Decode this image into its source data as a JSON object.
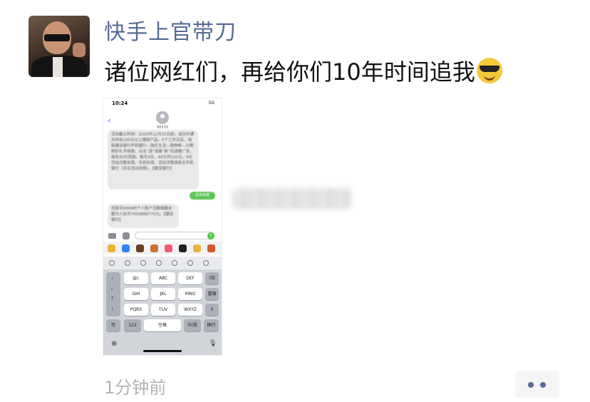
{
  "post": {
    "username": "快手上官带刀",
    "text": "诸位网红们，再给你们10年时间追我",
    "emoji": "sunglasses-smile",
    "time_ago": "1分钟前"
  },
  "screenshot": {
    "status_time": "10:24",
    "status_signal": "5G",
    "back_glyph": "‹",
    "contact_name": "95533",
    "message_in_1": "活动截止时间：2020年12月31日前，成功开通并持有100元以上理财产品，5个工作日后，领取建设银行手机银行—快乐生活—购物券—分期购好礼手续费。点击“源”或者“新”后请看广告，每有30元奖励，每月3次，40元共120元，9元活动次数有限，先到先得，活动详情请参见手机银行（详见活动说明）。【建设银行】",
    "message_out": "查询余额",
    "message_in_2": "您尾号9999的个人账户活期储蓄余额为人民币7004888770元。【建设银行】",
    "send_glyph": "↑",
    "keyboard_keys": [
      "@/.",
      "ABC",
      "DEF",
      "⌫",
      "GHI",
      "JKL",
      "MNO",
      "重输",
      "PQRS",
      "TUV",
      "WXYZ",
      "0",
      "符",
      "123",
      "空格",
      "中/英",
      "换行"
    ],
    "keyboard_left": [
      "，",
      "。",
      "？",
      "！"
    ],
    "globe_glyph": "⊕",
    "mic_glyph": "🎙"
  },
  "colors": {
    "username": "#576b95",
    "imessage_green": "#5fc45a",
    "meta_gray": "#b3b3b3"
  }
}
